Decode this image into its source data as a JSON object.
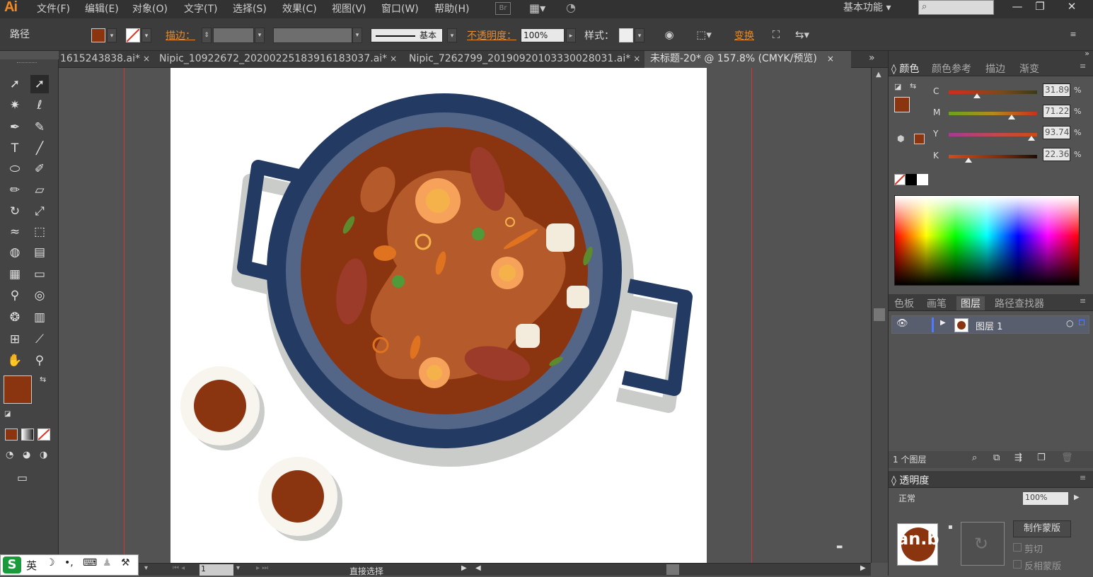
{
  "app": {
    "logo": "Ai"
  },
  "menu": [
    "文件(F)",
    "编辑(E)",
    "对象(O)",
    "文字(T)",
    "选择(S)",
    "效果(C)",
    "视图(V)",
    "窗口(W)",
    "帮助(H)"
  ],
  "workspace": {
    "label": "基本功能",
    "arrow": "▾"
  },
  "window_buttons": {
    "minimize": "—",
    "restore": "❐",
    "close": "✕"
  },
  "control": {
    "selection_label": "路径",
    "stroke_label": "描边：",
    "brush_label": "基本",
    "opacity_label": "不透明度：",
    "opacity_value": "100%",
    "style_label": "样式：",
    "transform_label": "变换",
    "fill_color": "#8b3410"
  },
  "tabs": [
    {
      "label": "1615243838.ai*",
      "close": "×"
    },
    {
      "label": "Nipic_10922672_20200225183916183037.ai*",
      "close": "×"
    },
    {
      "label": "Nipic_7262799_20190920103330028031.ai*",
      "close": "×"
    },
    {
      "label": "未标题-20* @ 157.8% (CMYK/预览)",
      "close": "×"
    }
  ],
  "tabs_overflow": "»",
  "toolbox": {
    "fill_color": "#8b3410"
  },
  "status": {
    "page": "1",
    "tool_name": "直接选择"
  },
  "ime": {
    "lang": "英"
  },
  "color_panel": {
    "tabs": [
      "颜色",
      "颜色参考",
      "描边",
      "渐变"
    ],
    "channels": [
      {
        "name": "C",
        "value": "31.89",
        "pct": 0.318,
        "gradient": "linear-gradient(to right,#c9301c,#c9301c 10%,#7a4a1a 60%,#3a3a1a)"
      },
      {
        "name": "M",
        "value": "71.22",
        "pct": 0.712,
        "gradient": "linear-gradient(to right,#6aa31e,#b28a1d 50%,#c9301c)"
      },
      {
        "name": "Y",
        "value": "93.74",
        "pct": 0.937,
        "gradient": "linear-gradient(to right,#a53b92,#c44a46 60%,#cc4a14)"
      },
      {
        "name": "K",
        "value": "22.36",
        "pct": 0.224,
        "gradient": "linear-gradient(to right,#d64a19,#7a2c0d 60%,#1e0c05)"
      }
    ],
    "pct_sign": "%"
  },
  "layers_panel": {
    "tabs": [
      "色板",
      "画笔",
      "图层",
      "路径查找器"
    ],
    "layer_name": "图层 1",
    "count_label": "1 个图层"
  },
  "transparency_panel": {
    "title": "透明度",
    "blend": "正常",
    "opacity": "100%",
    "make_mask": "制作蒙版",
    "clip": "剪切",
    "invert": "反相蒙版"
  },
  "watermark": {
    "text": "an.b"
  },
  "illustration": {
    "pot_rim": "#233a63",
    "pot_inner": "#536688",
    "soup_dark": "#8b3410",
    "soup_light": "#b55a2a",
    "shadow": "#c9ccc9",
    "egg_outer": "#f7a25a",
    "egg_yolk": "#f6b24a",
    "meat": "#9c3b2a",
    "cup_tea": "#8b3410",
    "cup_plate": "#f8f4ee"
  }
}
